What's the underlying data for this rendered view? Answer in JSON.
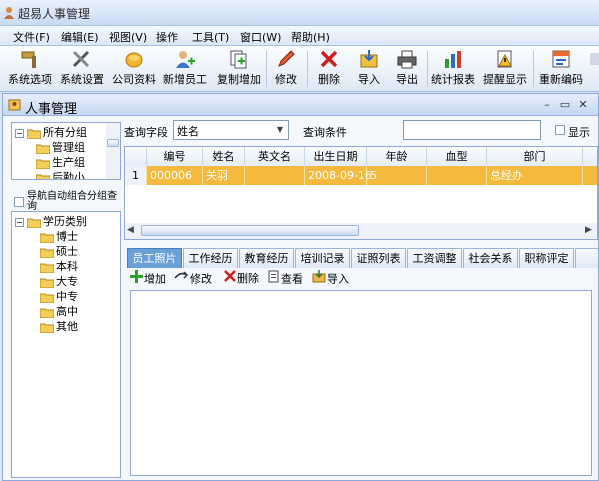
{
  "app": {
    "title": "超易人事管理"
  },
  "menu": [
    {
      "label": "文件(F)"
    },
    {
      "label": "编辑(E)"
    },
    {
      "label": "视图(V)"
    },
    {
      "label": "操作"
    },
    {
      "label": "工具(T)"
    },
    {
      "label": "窗口(W)"
    },
    {
      "label": "帮助(H)"
    }
  ],
  "toolbar": {
    "system_options": "系统选项",
    "system_settings": "系统设置",
    "company_info": "公司资料",
    "add_employee": "新增员工",
    "copy_add": "复制增加",
    "modify": "修改",
    "delete": "删除",
    "import": "导入",
    "export": "导出",
    "stats_report": "统计报表",
    "reminder": "提醒显示",
    "renumber": "重新编码"
  },
  "window": {
    "title": "人事管理",
    "min": "–",
    "restore": "▭",
    "close": "✕"
  },
  "tree1": {
    "root": "所有分组",
    "items": [
      "管理组",
      "生产组",
      "后勤小"
    ]
  },
  "nav_option": "导航自动组合分组查询",
  "tree2": {
    "root": "学历类别",
    "items": [
      "博士",
      "硕士",
      "本科",
      "大专",
      "中专",
      "高中",
      "其他"
    ]
  },
  "query": {
    "field_label": "查询字段",
    "field_value": "姓名",
    "condition_label": "查询条件",
    "condition_value": "",
    "show_label": "显示"
  },
  "grid": {
    "columns": [
      "编号",
      "姓名",
      "英文名",
      "出生日期",
      "年龄",
      "血型",
      "部门"
    ],
    "rows": [
      {
        "index": "1",
        "cells": [
          "000006",
          "关羽",
          "",
          "2008-09-16",
          "5",
          "",
          "总经办"
        ]
      }
    ]
  },
  "tabs": [
    "员工照片",
    "工作经历",
    "教育经历",
    "培训记录",
    "证照列表",
    "工资调整",
    "社会关系",
    "职称评定"
  ],
  "subtoolbar": {
    "add": "增加",
    "edit": "修改",
    "delete": "删除",
    "view": "查看",
    "import": "导入"
  },
  "colors": {
    "selected_row": "#f5b93d",
    "active_tab": "#6aa0d8",
    "window_bg": "#d9e6f7"
  }
}
